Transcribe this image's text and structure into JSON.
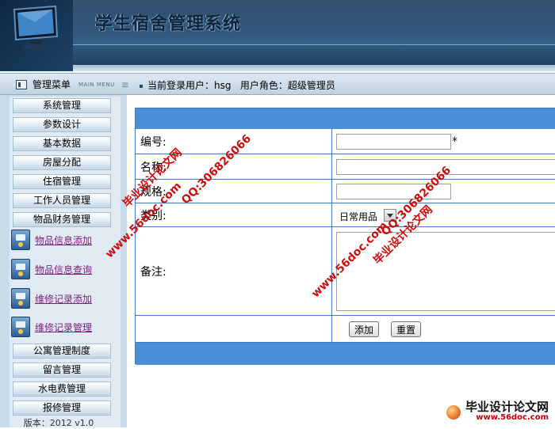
{
  "header": {
    "title": "学生宿舍管理系统"
  },
  "info_bar": {
    "menu_label": "管理菜单",
    "menu_sub": "MAIN MENU",
    "user_text": "当前登录用户：hsg   用户角色：超级管理员"
  },
  "sidebar": {
    "items": [
      {
        "label": "系统管理"
      },
      {
        "label": "参数设计"
      },
      {
        "label": "基本数据"
      },
      {
        "label": "房屋分配"
      },
      {
        "label": "住宿管理"
      },
      {
        "label": "工作人员管理"
      },
      {
        "label": "物品财务管理"
      }
    ],
    "sub_items": [
      {
        "label": "物品信息添加"
      },
      {
        "label": "物品信息查询"
      },
      {
        "label": "维修记录添加"
      },
      {
        "label": "维修记录管理"
      }
    ],
    "bottom_items": [
      {
        "label": "公寓管理制度"
      },
      {
        "label": "留言管理"
      },
      {
        "label": "水电费管理"
      },
      {
        "label": "报修管理"
      }
    ],
    "version": "版本：2012  v1.0"
  },
  "form": {
    "code_label": "编号:",
    "code_value": "",
    "required_mark": "*",
    "name_label": "名称:",
    "name_value": "",
    "spec_label": "规格:",
    "spec_value": "",
    "category_label": "类别:",
    "category_value": "日常用品",
    "remark_label": "备注:",
    "remark_value": "",
    "add_button": "添加",
    "reset_button": "重置"
  },
  "watermarks": {
    "site_name": "毕业设计论文网",
    "site_url": "www.56doc.com",
    "qq": "QQ:306826066",
    "footer_title": "毕业设计论文网",
    "footer_url": "www.56doc.com"
  },
  "colors": {
    "form_bar": "#4b8fd6",
    "form_border": "#3b7bbf",
    "link_purple": "#7a1e7a",
    "watermark_red": "#cc0000"
  }
}
